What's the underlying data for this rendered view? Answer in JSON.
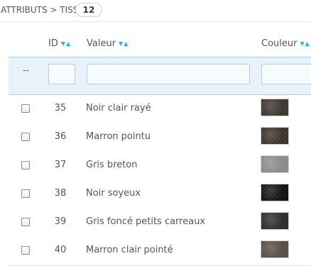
{
  "heading": {
    "title": "Attributs > Tissu",
    "count": "12"
  },
  "columns": {
    "id": "ID",
    "value": "Valeur",
    "color": "Couleur"
  },
  "filter": {
    "dash": "--"
  },
  "rows": [
    {
      "id": "35",
      "value": "Noir clair rayé",
      "swatch": "dark-striped-fabric",
      "color": "#3c342f"
    },
    {
      "id": "36",
      "value": "Marron pointu",
      "swatch": "brown-dotted-fabric",
      "color": "#3b3129"
    },
    {
      "id": "37",
      "value": "Gris breton",
      "swatch": "grey-fabric",
      "color": "#8a8a8a"
    },
    {
      "id": "38",
      "value": "Noir soyeux",
      "swatch": "black-silky-fabric",
      "color": "#101010"
    },
    {
      "id": "39",
      "value": "Gris foncé petits carreaux",
      "swatch": "dark-grey-checked-fabric",
      "color": "#2b2b2b"
    },
    {
      "id": "40",
      "value": "Marron clair pointé",
      "swatch": "light-brown-dotted-fabric",
      "color": "#544c45"
    }
  ]
}
